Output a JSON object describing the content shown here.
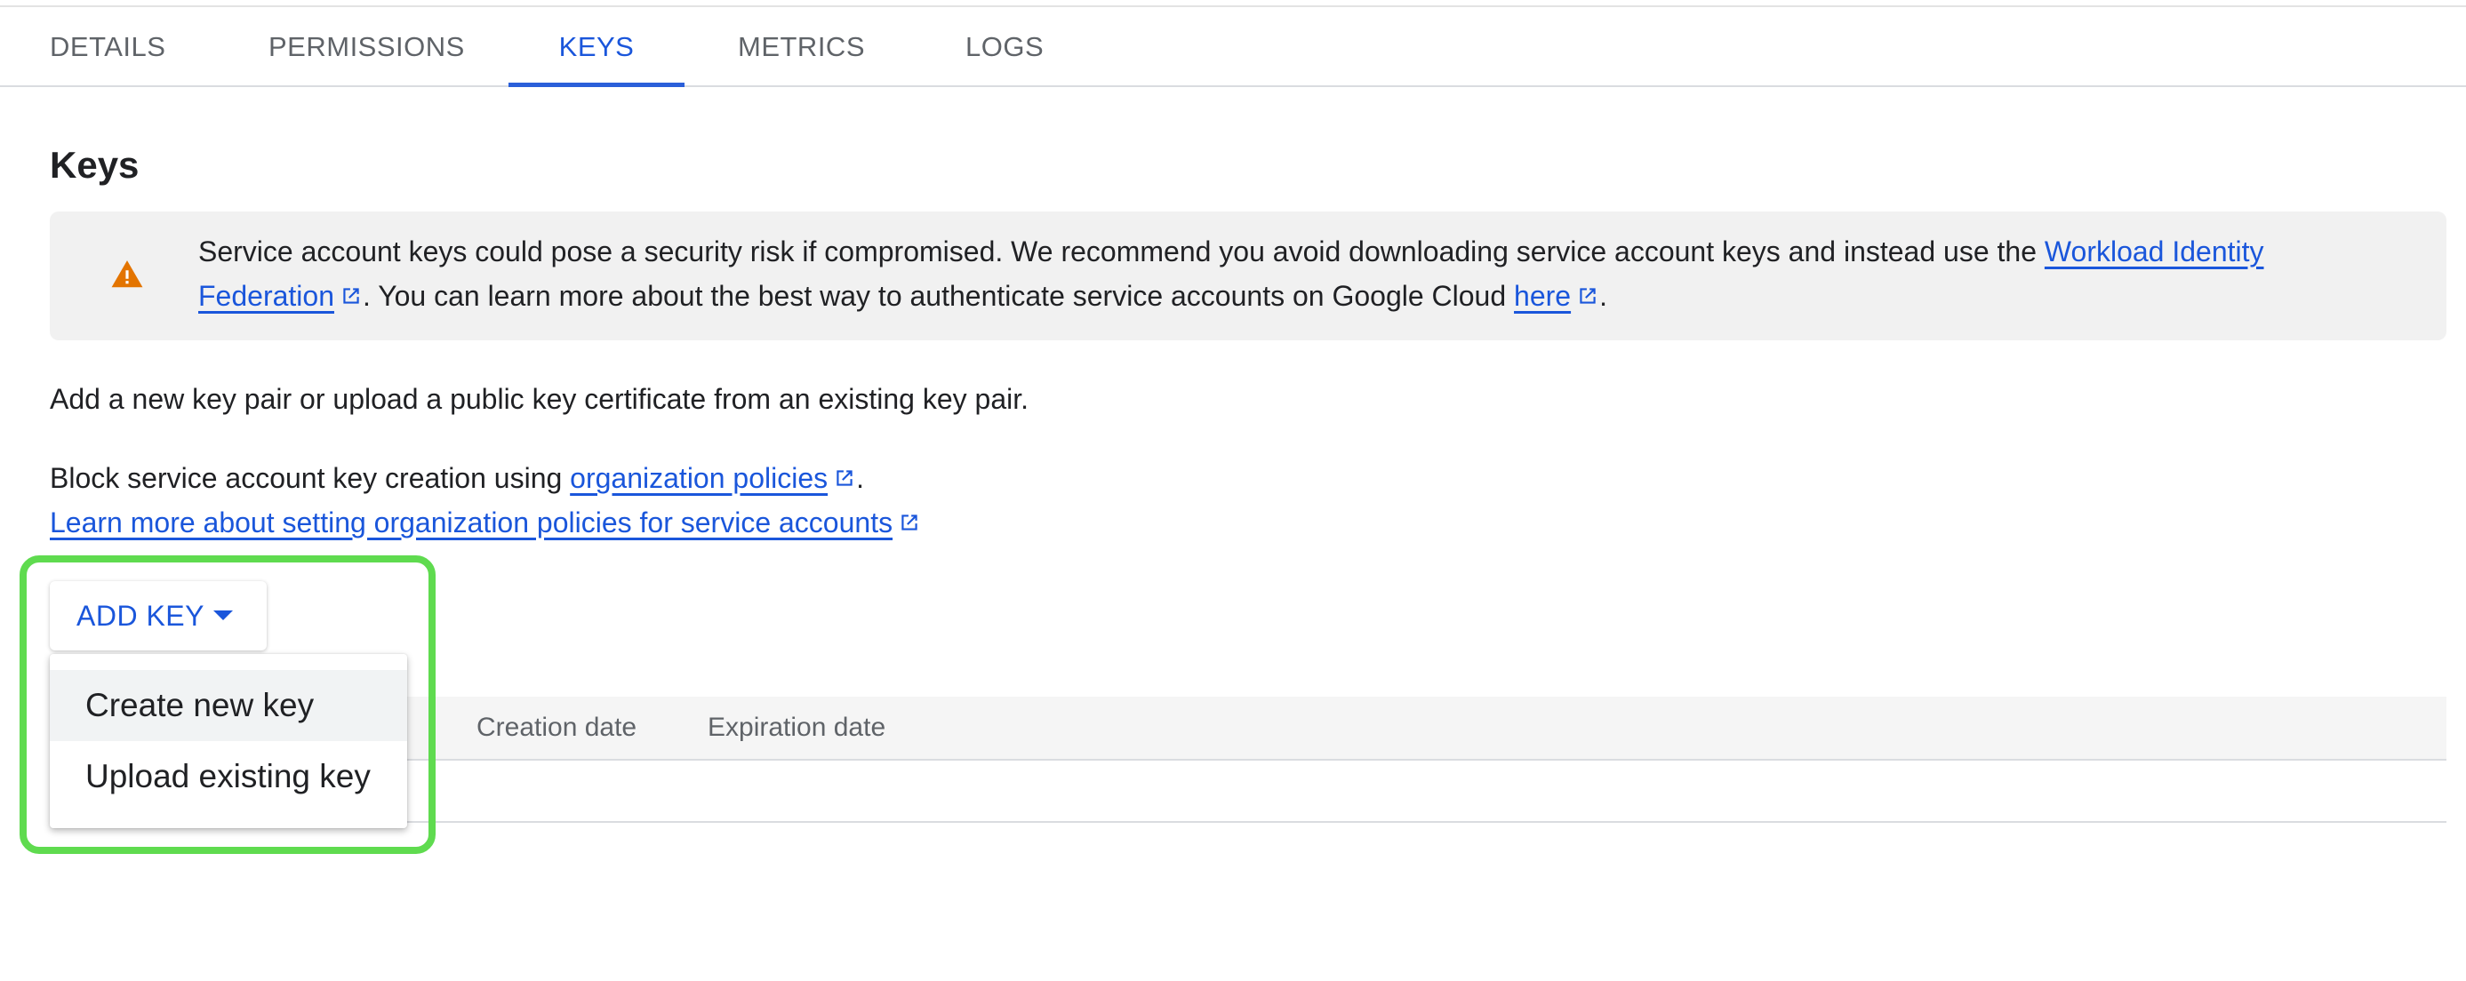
{
  "tabs": [
    {
      "label": "DETAILS",
      "active": false
    },
    {
      "label": "PERMISSIONS",
      "active": false
    },
    {
      "label": "KEYS",
      "active": true
    },
    {
      "label": "METRICS",
      "active": false
    },
    {
      "label": "LOGS",
      "active": false
    }
  ],
  "page": {
    "title": "Keys"
  },
  "banner": {
    "icon": "warning-icon",
    "text1": "Service account keys could pose a security risk if compromised. We recommend you avoid downloading service account keys and instead use the ",
    "link1": "Workload Identity Federation",
    "text2": ". You can learn more about the best way to authenticate service accounts on Google Cloud ",
    "link2": "here",
    "text3": "."
  },
  "intro": "Add a new key pair or upload a public key certificate from an existing key pair.",
  "policy": {
    "text": "Block service account key creation using ",
    "link": "organization policies",
    "suffix": ".",
    "learn_more": "Learn more about setting organization policies for service accounts"
  },
  "add_key": {
    "label": "ADD KEY"
  },
  "menu": {
    "items": [
      "Create new key",
      "Upload existing key"
    ]
  },
  "table": {
    "columns": [
      "Creation date",
      "Expiration date"
    ]
  },
  "colors": {
    "accent": "#1a56db",
    "warning": "#e37400",
    "highlight": "#5fdb4f"
  }
}
